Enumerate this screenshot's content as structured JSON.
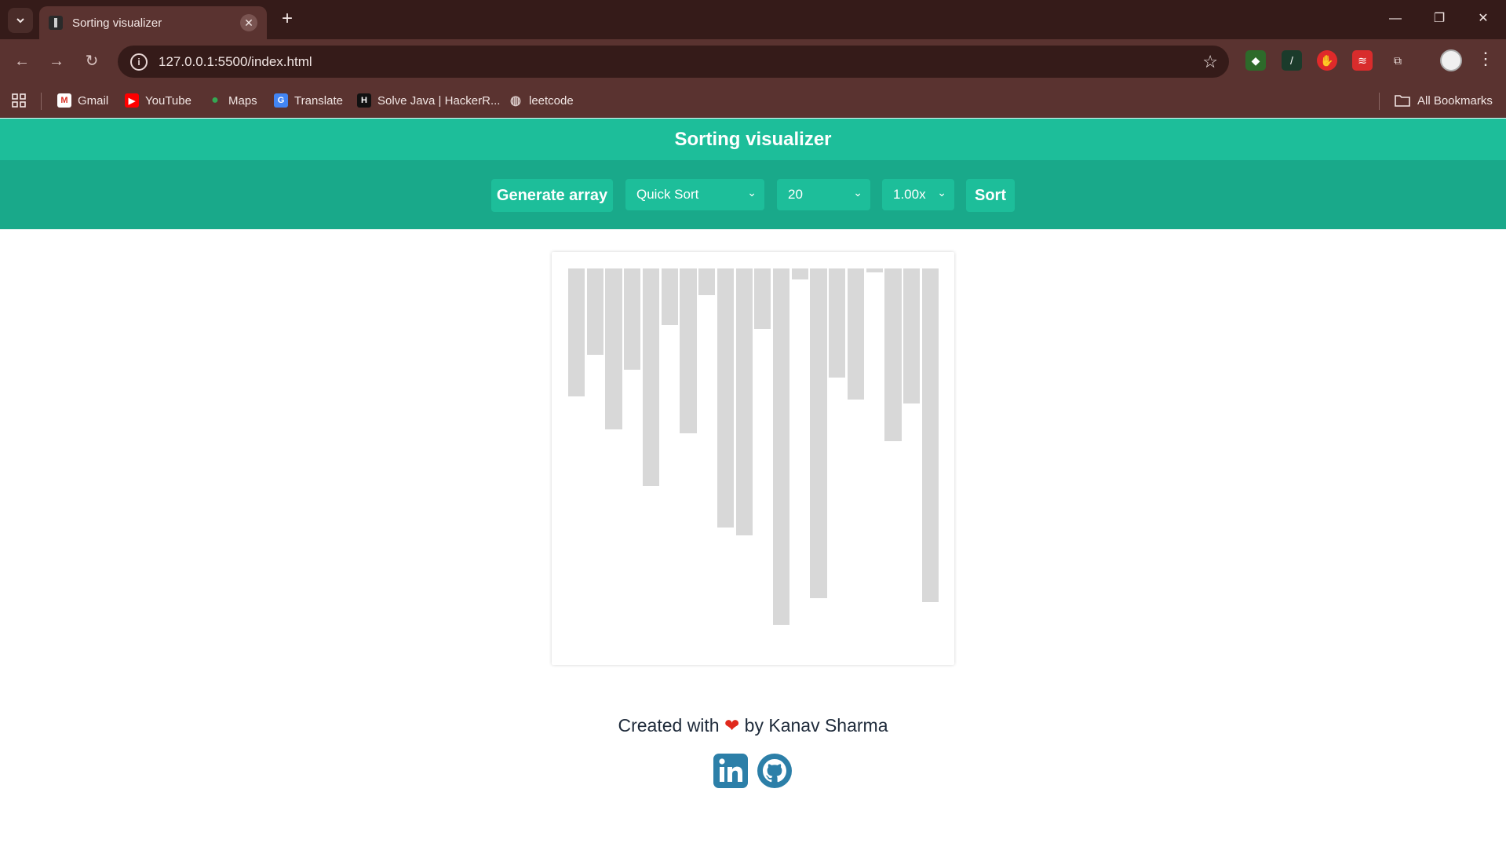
{
  "browser": {
    "tab_title": "Sorting visualizer",
    "url": "127.0.0.1:5500/index.html",
    "bookmarks": [
      {
        "label": "Gmail",
        "icon": "gmail-icon"
      },
      {
        "label": "YouTube",
        "icon": "youtube-icon"
      },
      {
        "label": "Maps",
        "icon": "maps-icon"
      },
      {
        "label": "Translate",
        "icon": "translate-icon"
      },
      {
        "label": "Solve Java | HackerR...",
        "icon": "hackerrank-icon"
      },
      {
        "label": "leetcode",
        "icon": "globe-icon"
      }
    ],
    "all_bookmarks": "All Bookmarks"
  },
  "app": {
    "title": "Sorting visualizer",
    "generate_label": "Generate array",
    "algorithm": "Quick Sort",
    "array_size": "20",
    "speed": "1.00x",
    "sort_label": "Sort"
  },
  "bars": {
    "values": [
      163,
      110,
      205,
      129,
      277,
      72,
      210,
      34,
      330,
      340,
      77,
      454,
      14,
      420,
      139,
      167,
      5,
      220,
      172,
      425
    ],
    "max_value": 480,
    "color": "#d8d8d8"
  },
  "footer": {
    "created_with": "Created with",
    "by": "by Kanav Sharma"
  },
  "colors": {
    "header": "#1dbe9a",
    "controls": "#19a98a",
    "social": "#2c7fa8"
  }
}
